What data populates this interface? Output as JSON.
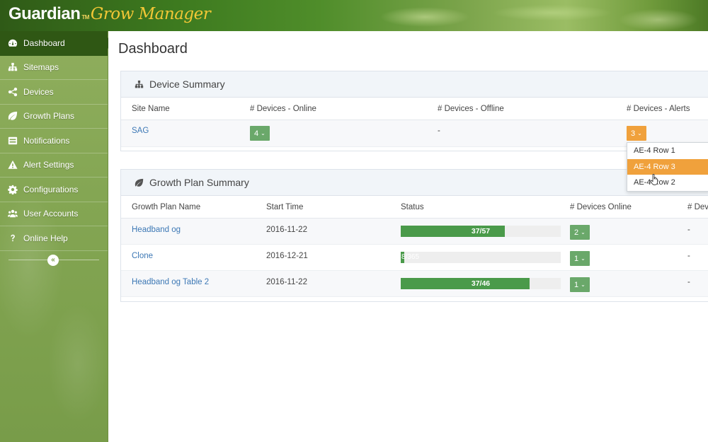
{
  "header": {
    "brand": "Guardian",
    "tm": "TM",
    "product": "Grow Manager"
  },
  "sidebar": {
    "items": [
      {
        "label": "Dashboard",
        "icon": "dashboard-icon"
      },
      {
        "label": "Sitemaps",
        "icon": "sitemap-icon"
      },
      {
        "label": "Devices",
        "icon": "share-icon"
      },
      {
        "label": "Growth Plans",
        "icon": "leaf-icon"
      },
      {
        "label": "Notifications",
        "icon": "notification-icon"
      },
      {
        "label": "Alert Settings",
        "icon": "warning-icon"
      },
      {
        "label": "Configurations",
        "icon": "gear-icon"
      },
      {
        "label": "User Accounts",
        "icon": "users-icon"
      },
      {
        "label": "Online Help",
        "icon": "help-icon"
      }
    ],
    "collapse_glyph": "«"
  },
  "page_title": "Dashboard",
  "device_summary": {
    "title": "Device Summary",
    "columns": [
      "Site Name",
      "# Devices - Online",
      "# Devices - Offline",
      "# Devices - Alerts"
    ],
    "rows": [
      {
        "site": "SAG",
        "online": "4",
        "offline": "-",
        "alerts": "3"
      }
    ],
    "alerts_dropdown": {
      "items": [
        "AE-4 Row 1",
        "AE-4 Row 3",
        "AE-4 Row 2"
      ],
      "highlighted_index": 1
    }
  },
  "growth_plan_summary": {
    "title": "Growth Plan Summary",
    "columns": [
      "Growth Plan Name",
      "Start Time",
      "Status",
      "# Devices Online",
      "# Dev"
    ],
    "rows": [
      {
        "name": "Headband og",
        "start": "2016-11-22",
        "status": "37/57",
        "progress": 0.649,
        "online": "2",
        "last": "-"
      },
      {
        "name": "Clone",
        "start": "2016-12-21",
        "status": "8/365",
        "progress": 0.022,
        "online": "1",
        "last": "-"
      },
      {
        "name": "Headband og Table 2",
        "start": "2016-11-22",
        "status": "37/46",
        "progress": 0.804,
        "online": "1",
        "last": "-"
      }
    ]
  },
  "colors": {
    "nav_active": "#2f5714",
    "sidebar": "#84a653",
    "progress": "#4a9a4a",
    "alert": "#f0a13c",
    "online": "#6aa86a",
    "link": "#3d78b5"
  }
}
